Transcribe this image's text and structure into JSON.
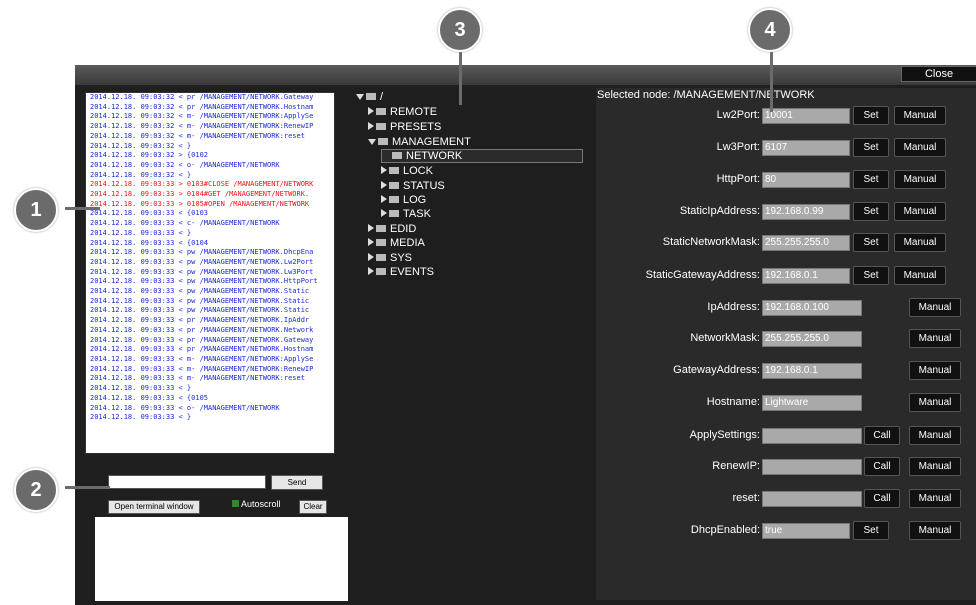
{
  "window": {
    "close_label": "Close"
  },
  "terminal": {
    "lines": [
      {
        "text": "2014.12.18. 09:03:32 < pr /MANAGEMENT/NETWORK.Gateway",
        "c": "blue"
      },
      {
        "text": "2014.12.18. 09:03:32 < pr /MANAGEMENT/NETWORK.Hostnam",
        "c": "blue"
      },
      {
        "text": "2014.12.18. 09:03:32 < m- /MANAGEMENT/NETWORK:ApplySe",
        "c": "blue"
      },
      {
        "text": "2014.12.18. 09:03:32 < m- /MANAGEMENT/NETWORK:RenewIP",
        "c": "blue"
      },
      {
        "text": "2014.12.18. 09:03:32 < m- /MANAGEMENT/NETWORK:reset",
        "c": "blue"
      },
      {
        "text": "2014.12.18. 09:03:32 < }",
        "c": "blue"
      },
      {
        "text": "2014.12.18. 09:03:32 > {0102",
        "c": "blue"
      },
      {
        "text": "2014.12.18. 09:03:32 < o- /MANAGEMENT/NETWORK",
        "c": "blue"
      },
      {
        "text": "2014.12.18. 09:03:32 < }",
        "c": "blue"
      },
      {
        "text": "2014.12.18. 09:03:33 > 0103#CLOSE /MANAGEMENT/NETWORK",
        "c": "red"
      },
      {
        "text": "2014.12.18. 09:03:33 > 0104#GET /MANAGEMENT/NETWORK.",
        "c": "red"
      },
      {
        "text": "2014.12.18. 09:03:33 > 0105#OPEN /MANAGEMENT/NETWORK",
        "c": "red"
      },
      {
        "text": "2014.12.18. 09:03:33 < {0103",
        "c": "blue"
      },
      {
        "text": "2014.12.18. 09:03:33 < c- /MANAGEMENT/NETWORK",
        "c": "blue"
      },
      {
        "text": "2014.12.18. 09:03:33 < }",
        "c": "blue"
      },
      {
        "text": "2014.12.18. 09:03:33 < {0104",
        "c": "blue"
      },
      {
        "text": "2014.12.18. 09:03:33 < pw /MANAGEMENT/NETWORK.DhcpEna",
        "c": "blue"
      },
      {
        "text": "2014.12.18. 09:03:33 < pw /MANAGEMENT/NETWORK.Lw2Port",
        "c": "blue"
      },
      {
        "text": "2014.12.18. 09:03:33 < pw /MANAGEMENT/NETWORK.Lw3Port",
        "c": "blue"
      },
      {
        "text": "2014.12.18. 09:03:33 < pw /MANAGEMENT/NETWORK.HttpPort",
        "c": "blue"
      },
      {
        "text": "2014.12.18. 09:03:33 < pw /MANAGEMENT/NETWORK.Static",
        "c": "blue"
      },
      {
        "text": "2014.12.18. 09:03:33 < pw /MANAGEMENT/NETWORK.Static",
        "c": "blue"
      },
      {
        "text": "2014.12.18. 09:03:33 < pw /MANAGEMENT/NETWORK.Static",
        "c": "blue"
      },
      {
        "text": "2014.12.18. 09:03:33 < pr /MANAGEMENT/NETWORK.IpAddr",
        "c": "blue"
      },
      {
        "text": "2014.12.18. 09:03:33 < pr /MANAGEMENT/NETWORK.Network",
        "c": "blue"
      },
      {
        "text": "2014.12.18. 09:03:33 < pr /MANAGEMENT/NETWORK.Gateway",
        "c": "blue"
      },
      {
        "text": "2014.12.18. 09:03:33 < pr /MANAGEMENT/NETWORK.Hostnam",
        "c": "blue"
      },
      {
        "text": "2014.12.18. 09:03:33 < m- /MANAGEMENT/NETWORK:ApplySe",
        "c": "blue"
      },
      {
        "text": "2014.12.18. 09:03:33 < m- /MANAGEMENT/NETWORK:RenewIP",
        "c": "blue"
      },
      {
        "text": "2014.12.18. 09:03:33 < m- /MANAGEMENT/NETWORK:reset",
        "c": "blue"
      },
      {
        "text": "2014.12.18. 09:03:33 < }",
        "c": "blue"
      },
      {
        "text": "2014.12.18. 09:03:33 < {0105",
        "c": "blue"
      },
      {
        "text": "2014.12.18. 09:03:33 < o- /MANAGEMENT/NETWORK",
        "c": "blue"
      },
      {
        "text": "2014.12.18. 09:03:33 < }",
        "c": "blue"
      }
    ],
    "send_label": "Send",
    "open_terminal_label": "Open terminal window",
    "autoscroll_label": "Autoscroll",
    "clear_label": "Clear"
  },
  "tree": {
    "root": "/",
    "items": [
      {
        "label": "REMOTE"
      },
      {
        "label": "PRESETS"
      },
      {
        "label": "MANAGEMENT"
      },
      {
        "label": "NETWORK"
      },
      {
        "label": "LOCK"
      },
      {
        "label": "STATUS"
      },
      {
        "label": "LOG"
      },
      {
        "label": "TASK"
      },
      {
        "label": "EDID"
      },
      {
        "label": "MEDIA"
      },
      {
        "label": "SYS"
      },
      {
        "label": "EVENTS"
      }
    ]
  },
  "props": {
    "selected_node": "Selected node: /MANAGEMENT/NETWORK",
    "rows": [
      {
        "label": "Lw2Port:",
        "value": "10001",
        "b1": "Set",
        "b2": "Manual"
      },
      {
        "label": "Lw3Port:",
        "value": "6107",
        "b1": "Set",
        "b2": "Manual"
      },
      {
        "label": "HttpPort:",
        "value": "80",
        "b1": "Set",
        "b2": "Manual"
      },
      {
        "label": "StaticIpAddress:",
        "value": "192.168.0.99",
        "b1": "Set",
        "b2": "Manual"
      },
      {
        "label": "StaticNetworkMask:",
        "value": "255.255.255.0",
        "b1": "Set",
        "b2": "Manual"
      },
      {
        "label": "StaticGatewayAddress:",
        "value": "192.168.0.1",
        "b1": "Set",
        "b2": "Manual"
      },
      {
        "label": "IpAddress:",
        "value": "192.168.0.100",
        "b1": "",
        "b2": "Manual"
      },
      {
        "label": "NetworkMask:",
        "value": "255.255.255.0",
        "b1": "",
        "b2": "Manual"
      },
      {
        "label": "GatewayAddress:",
        "value": "192.168.0.1",
        "b1": "",
        "b2": "Manual"
      },
      {
        "label": "Hostname:",
        "value": "Lightware",
        "b1": "",
        "b2": "Manual"
      },
      {
        "label": "ApplySettings:",
        "value": "",
        "b1": "Call",
        "b2": "Manual"
      },
      {
        "label": "RenewIP:",
        "value": "",
        "b1": "Call",
        "b2": "Manual"
      },
      {
        "label": "reset:",
        "value": "",
        "b1": "Call",
        "b2": "Manual"
      },
      {
        "label": "DhcpEnabled:",
        "value": "true",
        "b1": "Set",
        "b2": "Manual"
      }
    ]
  },
  "callouts": [
    "1",
    "2",
    "3",
    "4"
  ]
}
